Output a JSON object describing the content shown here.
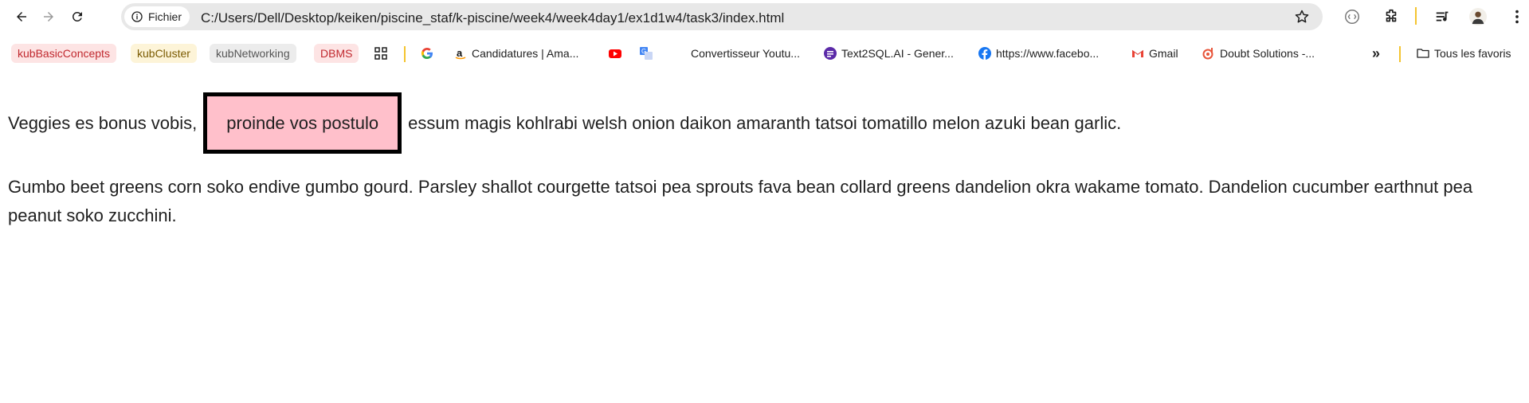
{
  "browser": {
    "chip_label": "Fichier",
    "url": "C:/Users/Dell/Desktop/keiken/piscine_staf/k-piscine/week4/week4day1/ex1d1w4/task3/index.html"
  },
  "bookmarks": {
    "items": [
      {
        "label": "kubBasicConcepts"
      },
      {
        "label": "kubCluster"
      },
      {
        "label": "kubNetworking"
      },
      {
        "label": "DBMS"
      },
      {
        "label": "Candidatures | Ama..."
      },
      {
        "label": "Convertisseur Youtu..."
      },
      {
        "label": "Text2SQL.AI - Gener..."
      },
      {
        "label": "https://www.facebo..."
      },
      {
        "label": "Gmail"
      },
      {
        "label": "Doubt Solutions -..."
      }
    ],
    "more_label": "»",
    "all_bookmarks_label": "Tous les favoris"
  },
  "page": {
    "para1_before": "Veggies es bonus vobis,",
    "highlight_text": "proinde vos postulo",
    "para1_after": "essum magis kohlrabi welsh onion daikon amaranth tatsoi tomatillo melon azuki bean garlic.",
    "para2": "Gumbo beet greens corn soko endive gumbo gourd. Parsley shallot courgette tatsoi pea sprouts fava bean collard greens dandelion okra wakame tomato. Dandelion cucumber earthnut pea peanut soko zucchini."
  },
  "colors": {
    "highlight_bg": "#ffc0cb",
    "highlight_border": "#000000"
  }
}
